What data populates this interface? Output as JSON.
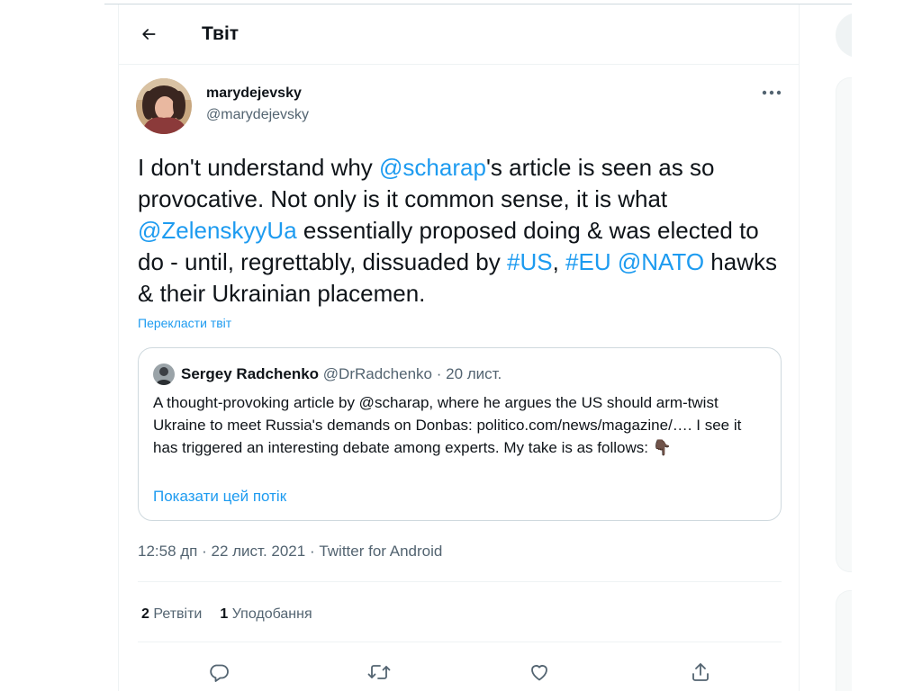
{
  "header": {
    "title": "Твіт"
  },
  "author": {
    "name": "marydejevsky",
    "handle": "@marydejevsky"
  },
  "tweet": {
    "seg_1": "I don't understand why ",
    "mention_1": "@scharap",
    "seg_2": "'s article is seen as so provocative. Not only is it common sense, it is what ",
    "mention_2": "@ZelenskyyUa",
    "seg_3": " essentially proposed doing & was elected to do - until, regrettably, dissuaded by ",
    "hashtag_1": "#US",
    "seg_4": ", ",
    "hashtag_2": "#EU",
    "seg_5": " ",
    "mention_3": "@NATO",
    "seg_6": " hawks & their Ukrainian placemen.",
    "translate_label": "Перекласти твіт"
  },
  "quote": {
    "name": "Sergey Radchenko",
    "handle": "@DrRadchenko",
    "separator": " · ",
    "date": "20 лист.",
    "text": "A thought-provoking article by @scharap, where he argues the US should arm-twist Ukraine to meet Russia's demands on Donbas: politico.com/news/magazine/…. I see it has triggered an interesting debate among experts. My take is as follows: 👇🏿",
    "show_thread": "Показати цей потік"
  },
  "meta": {
    "time": "12:58 дп",
    "separator": " · ",
    "date": "22 лист. 2021",
    "source": "Twitter for Android"
  },
  "stats": {
    "retweets_count": "2",
    "retweets_label": "Ретвіти",
    "likes_count": "1",
    "likes_label": "Уподобання"
  },
  "icons": {
    "back": "back-arrow-icon",
    "more": "more-icon",
    "reply": "reply-icon",
    "retweet": "retweet-icon",
    "like": "like-icon",
    "share": "share-icon"
  },
  "colors": {
    "accent": "#1d9bf0",
    "text_primary": "#0f1419",
    "text_secondary": "#536471",
    "border": "#eff3f4"
  }
}
